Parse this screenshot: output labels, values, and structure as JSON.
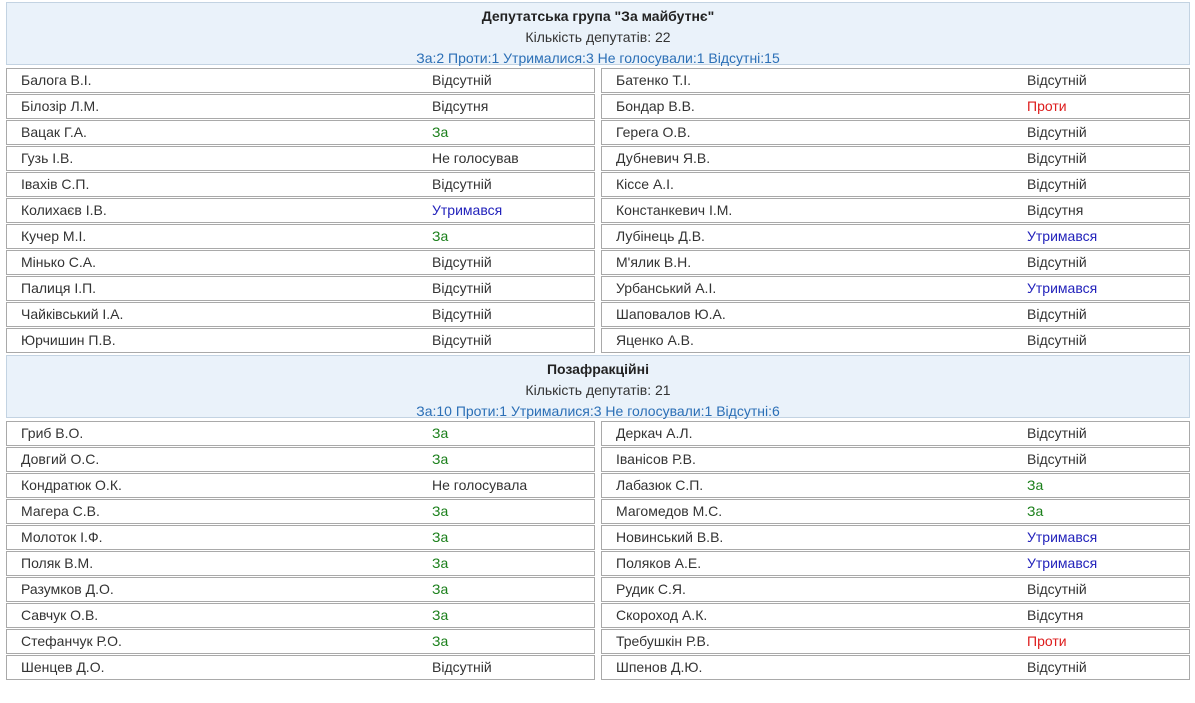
{
  "groups": [
    {
      "title": "Депутатська група \"За майбутнє\"",
      "count": "Кількість депутатів: 22",
      "stats": "За:2 Проти:1 Утрималися:3 Не голосували:1 Відсутні:15",
      "rows": [
        [
          {
            "name": "Балога В.І.",
            "vote": "Відсутній",
            "kind": "absent"
          },
          {
            "name": "Батенко Т.І.",
            "vote": "Відсутній",
            "kind": "absent"
          }
        ],
        [
          {
            "name": "Білозір Л.М.",
            "vote": "Відсутня",
            "kind": "absent"
          },
          {
            "name": "Бондар В.В.",
            "vote": "Проти",
            "kind": "against"
          }
        ],
        [
          {
            "name": "Вацак Г.А.",
            "vote": "За",
            "kind": "for"
          },
          {
            "name": "Герега О.В.",
            "vote": "Відсутній",
            "kind": "absent"
          }
        ],
        [
          {
            "name": "Гузь І.В.",
            "vote": "Не голосував",
            "kind": "novote"
          },
          {
            "name": "Дубневич Я.В.",
            "vote": "Відсутній",
            "kind": "absent"
          }
        ],
        [
          {
            "name": "Івахів С.П.",
            "vote": "Відсутній",
            "kind": "absent"
          },
          {
            "name": "Кіссе А.І.",
            "vote": "Відсутній",
            "kind": "absent"
          }
        ],
        [
          {
            "name": "Колихаєв І.В.",
            "vote": "Утримався",
            "kind": "abstain"
          },
          {
            "name": "Констанкевич І.М.",
            "vote": "Відсутня",
            "kind": "absent"
          }
        ],
        [
          {
            "name": "Кучер М.І.",
            "vote": "За",
            "kind": "for"
          },
          {
            "name": "Лубінець Д.В.",
            "vote": "Утримався",
            "kind": "abstain"
          }
        ],
        [
          {
            "name": "Мінько С.А.",
            "vote": "Відсутній",
            "kind": "absent"
          },
          {
            "name": "М'ялик В.Н.",
            "vote": "Відсутній",
            "kind": "absent"
          }
        ],
        [
          {
            "name": "Палиця І.П.",
            "vote": "Відсутній",
            "kind": "absent"
          },
          {
            "name": "Урбанський А.І.",
            "vote": "Утримався",
            "kind": "abstain"
          }
        ],
        [
          {
            "name": "Чайківський І.А.",
            "vote": "Відсутній",
            "kind": "absent"
          },
          {
            "name": "Шаповалов Ю.А.",
            "vote": "Відсутній",
            "kind": "absent"
          }
        ],
        [
          {
            "name": "Юрчишин П.В.",
            "vote": "Відсутній",
            "kind": "absent"
          },
          {
            "name": "Яценко А.В.",
            "vote": "Відсутній",
            "kind": "absent"
          }
        ]
      ]
    },
    {
      "title": "Позафракційні",
      "count": "Кількість депутатів: 21",
      "stats": "За:10 Проти:1 Утрималися:3 Не голосували:1 Відсутні:6",
      "rows": [
        [
          {
            "name": "Гриб В.О.",
            "vote": "За",
            "kind": "for"
          },
          {
            "name": "Деркач А.Л.",
            "vote": "Відсутній",
            "kind": "absent"
          }
        ],
        [
          {
            "name": "Довгий О.С.",
            "vote": "За",
            "kind": "for"
          },
          {
            "name": "Іванісов Р.В.",
            "vote": "Відсутній",
            "kind": "absent"
          }
        ],
        [
          {
            "name": "Кондратюк О.К.",
            "vote": "Не голосувала",
            "kind": "novote"
          },
          {
            "name": "Лабазюк С.П.",
            "vote": "За",
            "kind": "for"
          }
        ],
        [
          {
            "name": "Магера С.В.",
            "vote": "За",
            "kind": "for"
          },
          {
            "name": "Магомедов М.С.",
            "vote": "За",
            "kind": "for"
          }
        ],
        [
          {
            "name": "Молоток І.Ф.",
            "vote": "За",
            "kind": "for"
          },
          {
            "name": "Новинський В.В.",
            "vote": "Утримався",
            "kind": "abstain"
          }
        ],
        [
          {
            "name": "Поляк В.М.",
            "vote": "За",
            "kind": "for"
          },
          {
            "name": "Поляков А.Е.",
            "vote": "Утримався",
            "kind": "abstain"
          }
        ],
        [
          {
            "name": "Разумков Д.О.",
            "vote": "За",
            "kind": "for"
          },
          {
            "name": "Рудик С.Я.",
            "vote": "Відсутній",
            "kind": "absent"
          }
        ],
        [
          {
            "name": "Савчук О.В.",
            "vote": "За",
            "kind": "for"
          },
          {
            "name": "Скороход А.К.",
            "vote": "Відсутня",
            "kind": "absent"
          }
        ],
        [
          {
            "name": "Стефанчук Р.О.",
            "vote": "За",
            "kind": "for"
          },
          {
            "name": "Требушкін Р.В.",
            "vote": "Проти",
            "kind": "against"
          }
        ],
        [
          {
            "name": "Шенцев Д.О.",
            "vote": "Відсутній",
            "kind": "absent"
          },
          {
            "name": "Шпенов Д.Ю.",
            "vote": "Відсутній",
            "kind": "absent"
          }
        ]
      ]
    }
  ],
  "colors": {
    "for": "#1a7f1a",
    "against": "#dd1c1c",
    "abstain": "#2222bb",
    "header_bg": "#eaf2fa",
    "stats_text": "#2b6fb6"
  }
}
